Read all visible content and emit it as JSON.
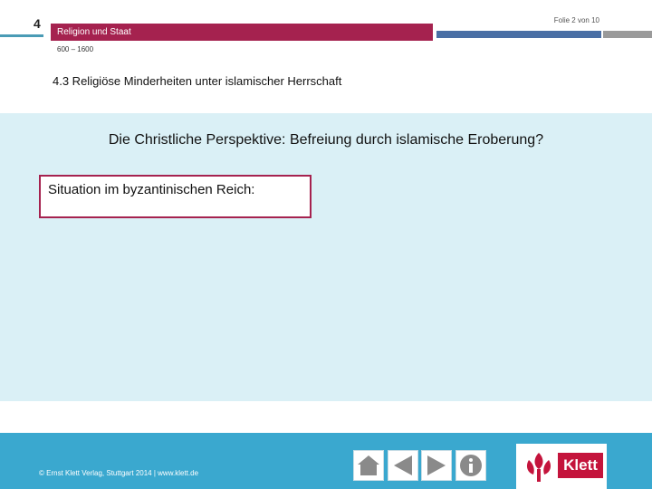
{
  "header": {
    "chapter": "4",
    "title": "Religion und Staat",
    "period": "600 – 1600",
    "slide_counter": "Folie 2 von 10"
  },
  "section": {
    "title": "4.3 Religiöse Minderheiten unter islamischer Herrschaft"
  },
  "main": {
    "heading": "Die Christliche Perspektive: Befreiung durch islamische Eroberung?",
    "situation_label": "Situation im byzantinischen Reich:"
  },
  "footer": {
    "copyright": "© Ernst Klett Verlag, Stuttgart 2014 | www.klett.de",
    "nav": [
      {
        "icon": "home-icon"
      },
      {
        "icon": "previous-arrow-icon"
      },
      {
        "icon": "next-arrow-icon"
      },
      {
        "icon": "info-icon"
      }
    ],
    "logo_text": "Klett"
  },
  "colors": {
    "accent_red": "#a5224f",
    "content_bg": "#daf0f6",
    "footer_blue": "#3aa8cf",
    "brand_red": "#c4143c"
  }
}
